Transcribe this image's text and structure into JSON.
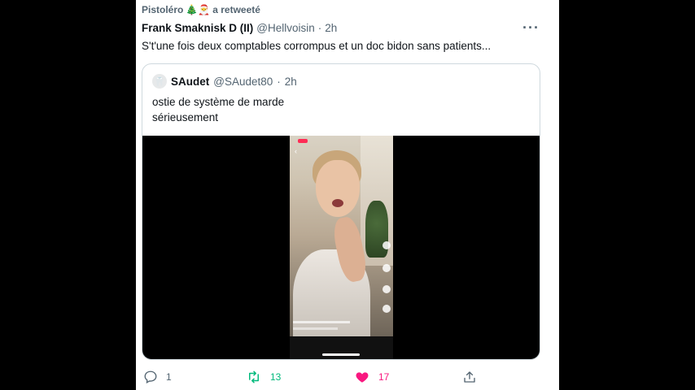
{
  "retweet": {
    "label": "Pistoléro",
    "emojis": "🎄🎅",
    "action": "a retweeté"
  },
  "tweet": {
    "author_name": "Frank Smaknisk D (II)",
    "handle": "@Hellvoisin",
    "separator": "·",
    "time": "2h",
    "more": "···",
    "text": "S't'une fois deux comptables corrompus et un doc bidon sans patients..."
  },
  "quote": {
    "avatar_glyph": "🦷",
    "author_name": "SAudet",
    "handle": "@SAudet80",
    "separator": "·",
    "time": "2h",
    "text_line1": "ostie de système de marde",
    "text_line2": "sérieusement"
  },
  "actions": {
    "reply_count": "1",
    "retweet_count": "13",
    "like_count": "17"
  },
  "colors": {
    "retweet": "#00ba7c",
    "like": "#f91880",
    "secondary_text": "#536471",
    "border": "#cfd9de"
  },
  "icons": [
    "retweet-icon",
    "more-icon",
    "reply-icon",
    "like-icon",
    "share-icon"
  ]
}
